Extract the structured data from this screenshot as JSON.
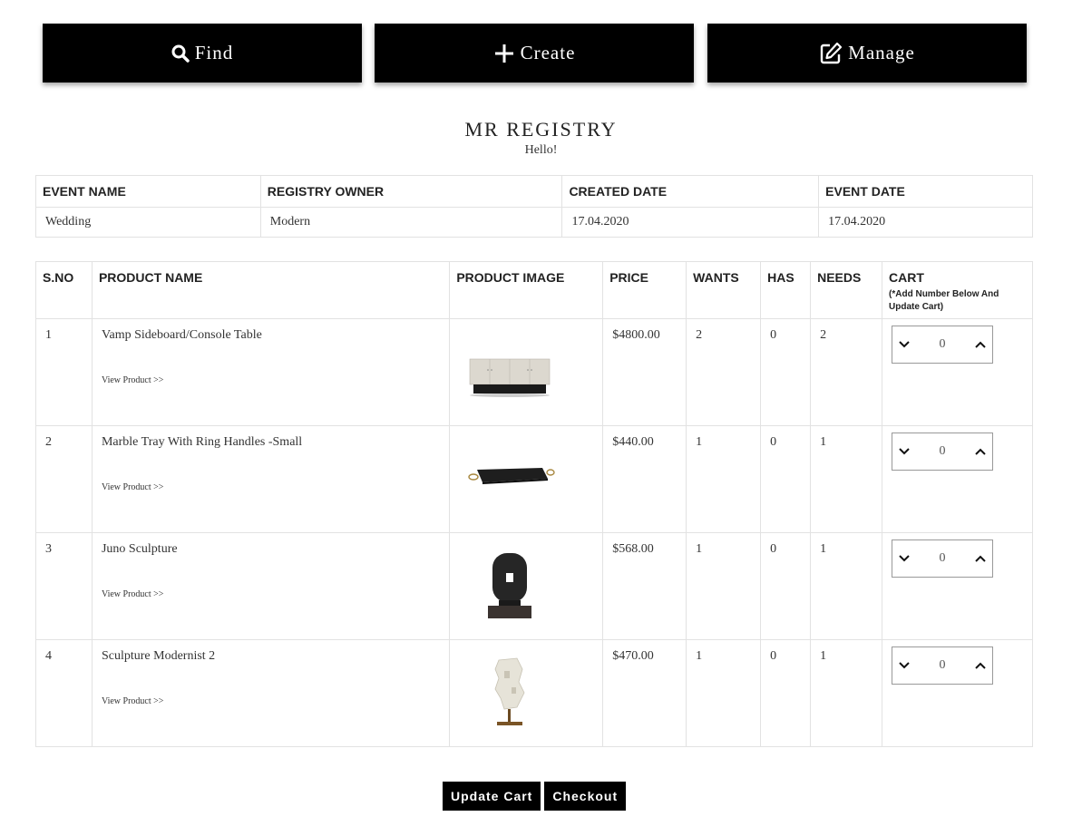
{
  "nav": {
    "find_label": "Find",
    "create_label": "Create",
    "manage_label": "Manage"
  },
  "registry": {
    "title": "MR REGISTRY",
    "greeting": "Hello!"
  },
  "event_table": {
    "headers": [
      "EVENT NAME",
      "REGISTRY OWNER",
      "CREATED DATE",
      "EVENT DATE"
    ],
    "row": [
      "Wedding",
      "Modern",
      "17.04.2020",
      "17.04.2020"
    ]
  },
  "product_table": {
    "headers": {
      "sno": "S.NO",
      "name": "PRODUCT NAME",
      "image": "PRODUCT IMAGE",
      "price": "PRICE",
      "wants": "WANTS",
      "has": "HAS",
      "needs": "NEEDS",
      "cart": "CART",
      "cart_note": "(*Add Number Below And Update Cart)"
    },
    "view_link": "View Product >>",
    "rows": [
      {
        "sno": "1",
        "name": "Vamp Sideboard/Console Table",
        "image": "sideboard-image",
        "price": "$4800.00",
        "wants": "2",
        "has": "0",
        "needs": "2",
        "qty": "0"
      },
      {
        "sno": "2",
        "name": "Marble Tray With Ring Handles -Small",
        "image": "tray-image",
        "price": "$440.00",
        "wants": "1",
        "has": "0",
        "needs": "1",
        "qty": "0"
      },
      {
        "sno": "3",
        "name": "Juno Sculpture",
        "image": "juno-sculpture-image",
        "price": "$568.00",
        "wants": "1",
        "has": "0",
        "needs": "1",
        "qty": "0"
      },
      {
        "sno": "4",
        "name": "Sculpture Modernist 2",
        "image": "modernist-sculpture-image",
        "price": "$470.00",
        "wants": "1",
        "has": "0",
        "needs": "1",
        "qty": "0"
      }
    ]
  },
  "actions": {
    "update_cart": "Update Cart",
    "checkout": "Checkout"
  },
  "colors": {
    "button_bg": "#000000",
    "button_text": "#ffffff",
    "border": "#e2e2e2"
  },
  "icons": [
    "search-icon",
    "plus-icon",
    "edit-icon",
    "chevron-down-icon",
    "chevron-up-icon"
  ]
}
